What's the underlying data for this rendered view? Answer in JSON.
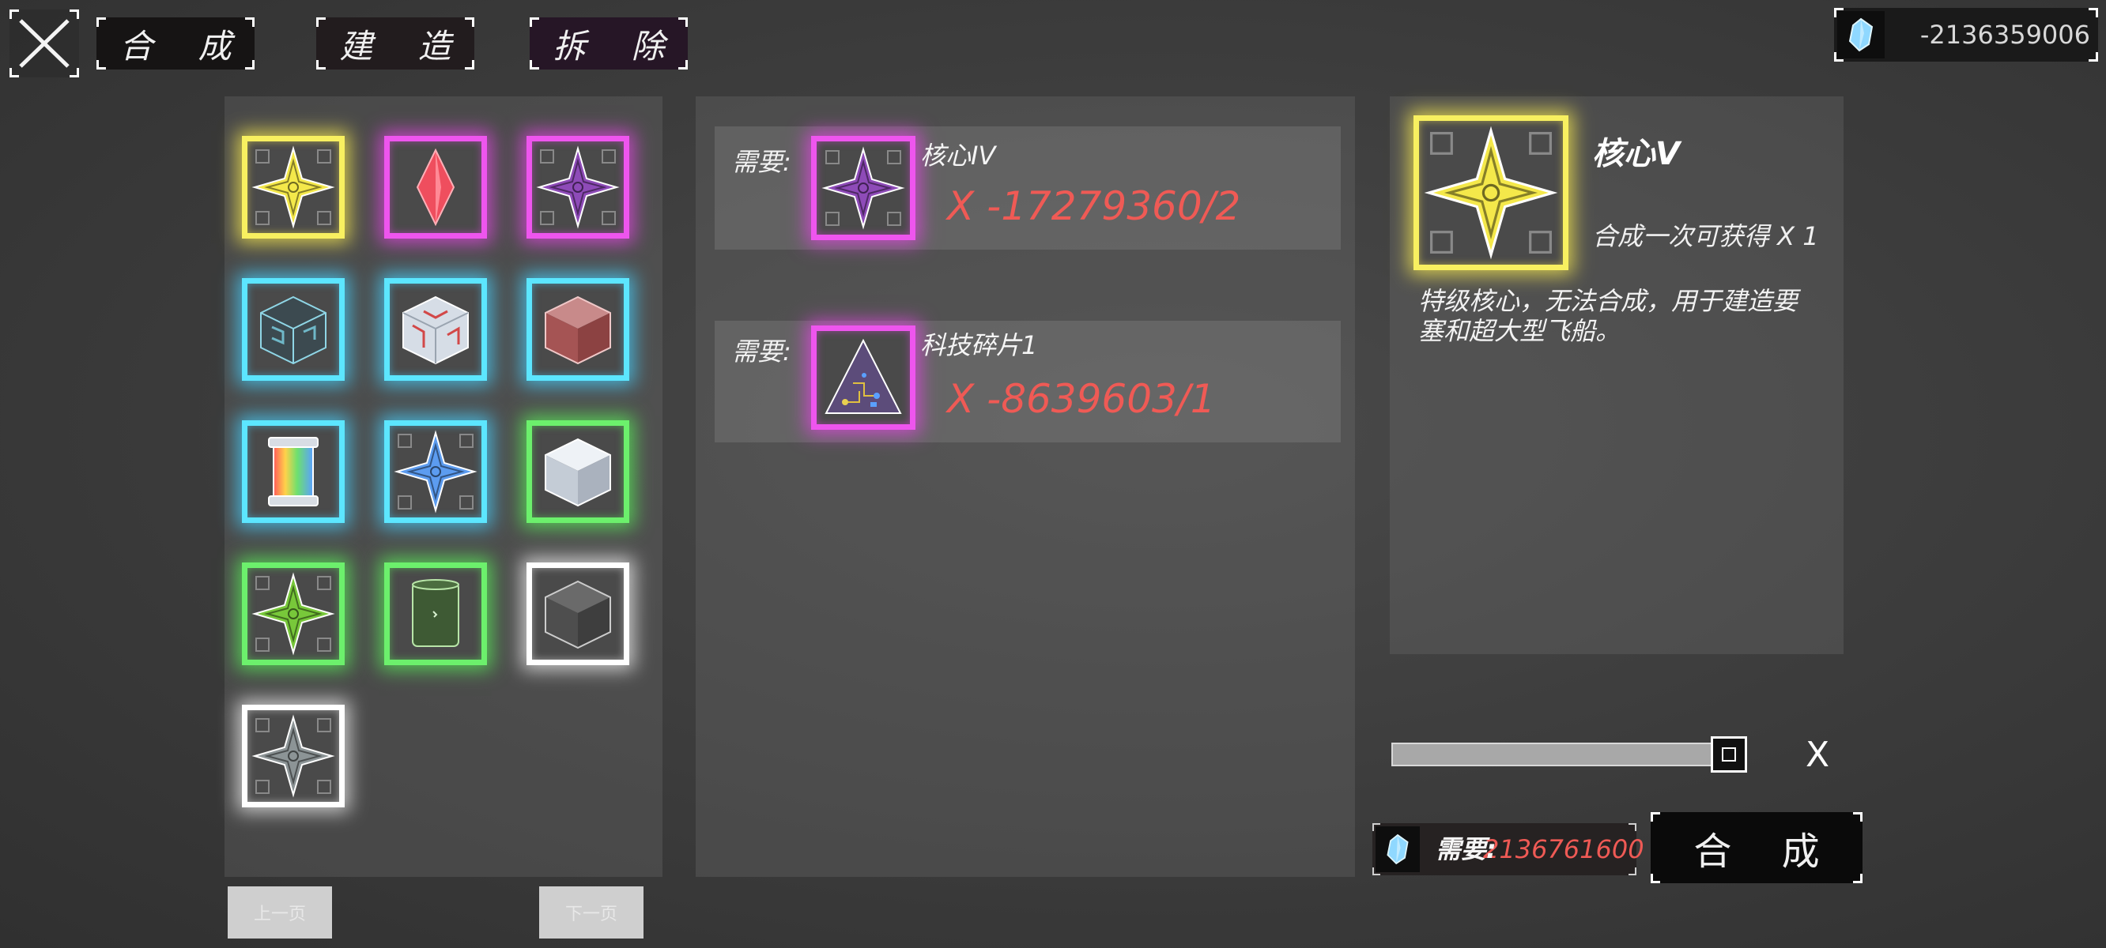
{
  "header": {
    "close_icon": "close-x-icon",
    "tabs": [
      {
        "label": "合 成"
      },
      {
        "label": "建 造"
      },
      {
        "label": "拆 除"
      }
    ],
    "currency": {
      "icon": "crystal-icon",
      "value": "-2136359006"
    }
  },
  "inventory": {
    "items": [
      {
        "icon": "core-v-star-icon",
        "glow": "yellow"
      },
      {
        "icon": "red-gem-icon",
        "glow": "magenta"
      },
      {
        "icon": "core-iv-star-icon",
        "glow": "magenta"
      },
      {
        "icon": "dark-maze-cube-icon",
        "glow": "cyan"
      },
      {
        "icon": "red-circuit-cube-icon",
        "glow": "cyan"
      },
      {
        "icon": "red-cube-icon",
        "glow": "cyan"
      },
      {
        "icon": "rainbow-canister-icon",
        "glow": "cyan"
      },
      {
        "icon": "blue-star-icon",
        "glow": "cyan"
      },
      {
        "icon": "white-cube-icon",
        "glow": "green"
      },
      {
        "icon": "green-star-icon",
        "glow": "green"
      },
      {
        "icon": "green-canister-icon",
        "glow": "green"
      },
      {
        "icon": "gray-cube-icon",
        "glow": "white"
      },
      {
        "icon": "gray-star-icon",
        "glow": "white"
      }
    ],
    "prev_page": "上一页",
    "next_page": "下一页"
  },
  "requirements": {
    "rows": [
      {
        "label": "需要:",
        "name": "核心IV",
        "count": "X -17279360/2",
        "icon": "core-iv-star-icon"
      },
      {
        "label": "需要:",
        "name": "科技碎片1",
        "count": "X -8639603/1",
        "icon": "tech-fragment-triangle-icon"
      }
    ]
  },
  "detail": {
    "name": "核心V",
    "yield": "合成一次可获得 X 1",
    "description": "特级核心，无法合成，用于建造要塞和超大型飞船。",
    "icon": "core-v-star-icon"
  },
  "quantity": {
    "fraction": 1.0,
    "multiplier": "X"
  },
  "cost": {
    "label": "需要:",
    "value": "2136761600",
    "icon": "crystal-icon"
  },
  "craft_button": "合 成",
  "colors": {
    "yellow": "#f8f060",
    "magenta": "#ee55ee",
    "cyan": "#5ce6ff",
    "green": "#6cf06c",
    "red_text": "#ef5a55"
  }
}
